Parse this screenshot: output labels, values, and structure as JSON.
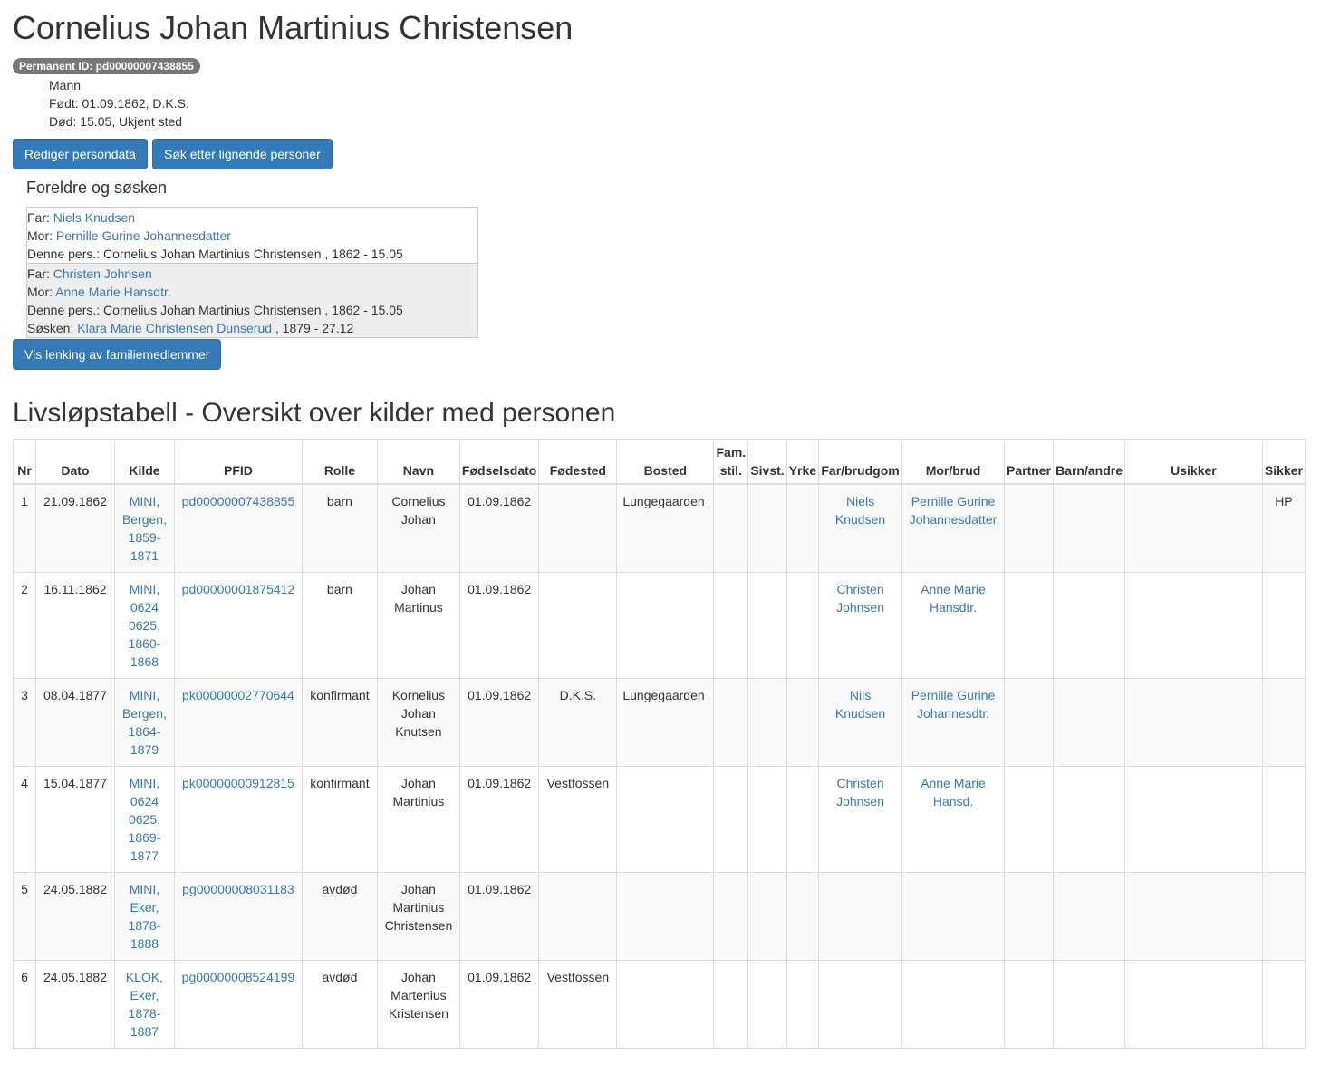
{
  "person": {
    "name": "Cornelius Johan Martinius Christensen",
    "permanent_id": "Permanent ID: pd00000007438855",
    "sex": "Mann",
    "born": "Født: 01.09.1862, D.K.S.",
    "died": "Død: 15.05, Ukjent sted"
  },
  "buttons": {
    "edit": "Rediger persondata",
    "search": "Søk etter lignende personer",
    "show_links": "Vis lenking av familiemedlemmer"
  },
  "family": {
    "heading": "Foreldre og søsken",
    "groups": [
      {
        "far_label": "Far: ",
        "far": "Niels Knudsen",
        "mor_label": "Mor: ",
        "mor": "Pernille Gurine Johannesdatter",
        "self": "Denne pers.: Cornelius Johan Martinius Christensen , 1862 - 15.05"
      },
      {
        "far_label": "Far: ",
        "far": "Christen Johnsen",
        "mor_label": "Mor: ",
        "mor": "Anne Marie Hansdtr.",
        "self": "Denne pers.: Cornelius Johan Martinius Christensen , 1862 - 15.05",
        "sibling_label": "Søsken: ",
        "sibling": "Klara Marie Christensen Dunserud",
        "sibling_years": " , 1879 - 27.12"
      }
    ]
  },
  "timeline": {
    "heading": "Livsløpstabell - Oversikt over kilder med personen",
    "columns": [
      "Nr",
      "Dato",
      "Kilde",
      "PFID",
      "Rolle",
      "Navn",
      "Fødselsdato",
      "Fødested",
      "Bosted",
      "Fam. stil.",
      "Sivst.",
      "Yrke",
      "Far/brudgom",
      "Mor/brud",
      "Partner",
      "Barn/andre",
      "Usikker",
      "Sikker"
    ],
    "rows": [
      {
        "nr": "1",
        "dato": "21.09.1862",
        "kilde": "MINI, Bergen, 1859-1871",
        "pfid": "pd00000007438855",
        "rolle": "barn",
        "navn": "Cornelius Johan",
        "fodselsdato": "01.09.1862",
        "fodested": "",
        "bosted": "Lungegaarden",
        "famstil": "",
        "sivst": "",
        "yrke": "",
        "far": "Niels Knudsen",
        "mor": "Pernille Gurine Johannesdatter",
        "partner": "",
        "barn": "",
        "usikker": "",
        "sikker": "HP"
      },
      {
        "nr": "2",
        "dato": "16.11.1862",
        "kilde": "MINI, 0624 0625, 1860-1868",
        "pfid": "pd00000001875412",
        "rolle": "barn",
        "navn": "Johan Martinus",
        "fodselsdato": "01.09.1862",
        "fodested": "",
        "bosted": "",
        "famstil": "",
        "sivst": "",
        "yrke": "",
        "far": "Christen Johnsen",
        "mor": "Anne Marie Hansdtr.",
        "partner": "",
        "barn": "",
        "usikker": "",
        "sikker": ""
      },
      {
        "nr": "3",
        "dato": "08.04.1877",
        "kilde": "MINI, Bergen, 1864-1879",
        "pfid": "pk00000002770644",
        "rolle": "konfirmant",
        "navn": "Kornelius Johan Knutsen",
        "fodselsdato": "01.09.1862",
        "fodested": "D.K.S.",
        "bosted": "Lungegaarden",
        "famstil": "",
        "sivst": "",
        "yrke": "",
        "far": "Nils Knudsen",
        "mor": "Pernille Gurine Johannesdtr.",
        "partner": "",
        "barn": "",
        "usikker": "",
        "sikker": ""
      },
      {
        "nr": "4",
        "dato": "15.04.1877",
        "kilde": "MINI, 0624 0625, 1869-1877",
        "pfid": "pk00000000912815",
        "rolle": "konfirmant",
        "navn": "Johan Martinius",
        "fodselsdato": "01.09.1862",
        "fodested": "Vestfossen",
        "bosted": "",
        "famstil": "",
        "sivst": "",
        "yrke": "",
        "far": "Christen Johnsen",
        "mor": "Anne Marie Hansd.",
        "partner": "",
        "barn": "",
        "usikker": "",
        "sikker": ""
      },
      {
        "nr": "5",
        "dato": "24.05.1882",
        "kilde": "MINI, Eker, 1878-1888",
        "pfid": "pg00000008031183",
        "rolle": "avdød",
        "navn": "Johan Martinius Christensen",
        "fodselsdato": "01.09.1862",
        "fodested": "",
        "bosted": "",
        "famstil": "",
        "sivst": "",
        "yrke": "",
        "far": "",
        "mor": "",
        "partner": "",
        "barn": "",
        "usikker": "",
        "sikker": ""
      },
      {
        "nr": "6",
        "dato": "24.05.1882",
        "kilde": "KLOK, Eker, 1878-1887",
        "pfid": "pg00000008524199",
        "rolle": "avdød",
        "navn": "Johan Martenius Kristensen",
        "fodselsdato": "01.09.1862",
        "fodested": "Vestfossen",
        "bosted": "",
        "famstil": "",
        "sivst": "",
        "yrke": "",
        "far": "",
        "mor": "",
        "partner": "",
        "barn": "",
        "usikker": "",
        "sikker": ""
      }
    ]
  }
}
